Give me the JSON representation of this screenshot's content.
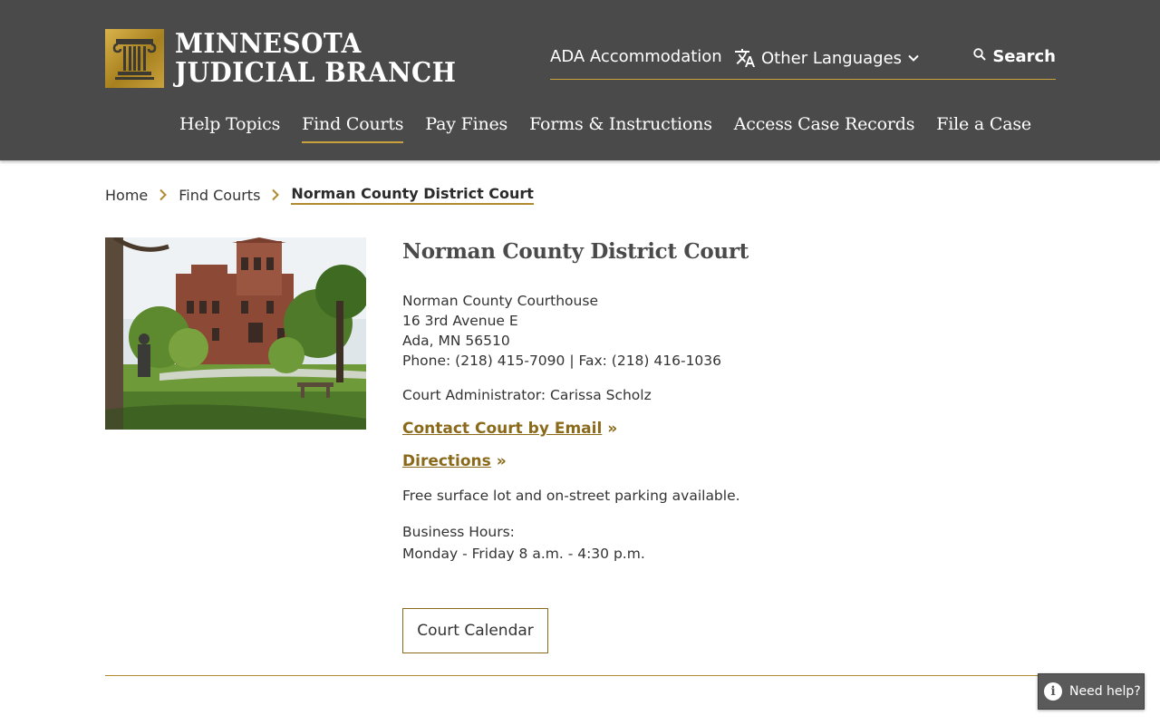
{
  "header": {
    "logo_line1": "MINNESOTA",
    "logo_line2": "JUDICIAL BRANCH",
    "utility": {
      "ada_label": "ADA Accommodation",
      "languages_label": "Other Languages",
      "search_label": "Search"
    },
    "nav": [
      {
        "label": "Help Topics",
        "active": false
      },
      {
        "label": "Find Courts",
        "active": true
      },
      {
        "label": "Pay Fines",
        "active": false
      },
      {
        "label": "Forms & Instructions",
        "active": false
      },
      {
        "label": "Access Case Records",
        "active": false
      },
      {
        "label": "File a Case",
        "active": false
      }
    ]
  },
  "breadcrumb": {
    "home": "Home",
    "parent": "Find Courts",
    "current": "Norman County District Court"
  },
  "court": {
    "title": "Norman County District Court",
    "building": "Norman County Courthouse",
    "street": "16 3rd Avenue E",
    "city": "Ada, MN 56510",
    "phone_fax": "Phone: (218) 415-7090 | Fax: (218) 416-1036",
    "administrator": "Court Administrator: Carissa Scholz",
    "contact_link": "Contact Court by Email",
    "directions_link": "Directions",
    "link_suffix": "»",
    "parking": "Free surface lot and on-street parking available.",
    "hours_label": "Business Hours:",
    "hours_value": "Monday - Friday 8 a.m. - 4:30 p.m.",
    "calendar_button": "Court Calendar"
  },
  "help_widget": {
    "label": "Need help?"
  },
  "colors": {
    "header_bg": "#4a4a4a",
    "accent_gold": "#c9a23c",
    "link_gold": "#8a6a1a"
  }
}
